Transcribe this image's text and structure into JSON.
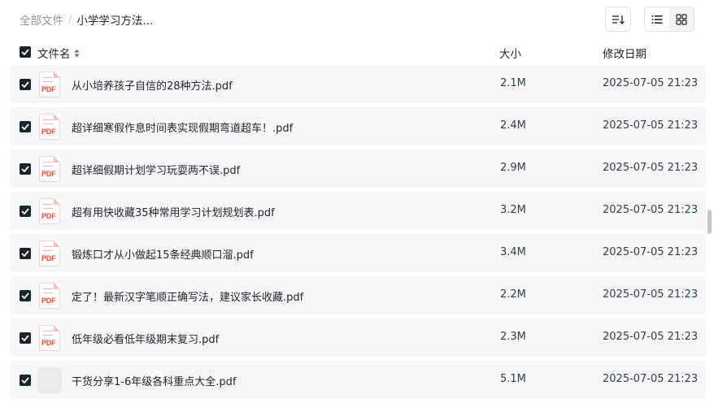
{
  "breadcrumb": {
    "root": "全部文件",
    "separator": "/",
    "current": "小学学习方法..."
  },
  "toolbar": {
    "sort_icon": "sort-list-icon",
    "list_view_icon": "list-view-icon",
    "grid_view_icon": "grid-view-icon",
    "active_view": "list"
  },
  "table": {
    "headers": {
      "name": "文件名",
      "size": "大小",
      "modified": "修改日期"
    },
    "select_all_checked": true,
    "rows": [
      {
        "name": "从小培养孩子自信的28种方法.pdf",
        "size": "2.1M",
        "modified": "2025-07-05 21:23",
        "icon": "pdf-file-icon",
        "checked": true
      },
      {
        "name": "超详细寒假作息时间表实现假期弯道超车！.pdf",
        "size": "2.4M",
        "modified": "2025-07-05 21:23",
        "icon": "pdf-file-icon",
        "checked": true
      },
      {
        "name": "超详细假期计划学习玩耍两不误.pdf",
        "size": "2.9M",
        "modified": "2025-07-05 21:23",
        "icon": "pdf-file-icon",
        "checked": true
      },
      {
        "name": "超有用快收藏35种常用学习计划规划表.pdf",
        "size": "3.2M",
        "modified": "2025-07-05 21:23",
        "icon": "pdf-file-icon",
        "checked": true
      },
      {
        "name": "锻炼口才从小做起15条经典顺口溜.pdf",
        "size": "3.4M",
        "modified": "2025-07-05 21:23",
        "icon": "pdf-file-icon",
        "checked": true
      },
      {
        "name": "定了！最新汉字笔顺正确写法，建议家长收藏.pdf",
        "size": "2.2M",
        "modified": "2025-07-05 21:23",
        "icon": "pdf-file-icon",
        "checked": true
      },
      {
        "name": "低年级必看低年级期末复习.pdf",
        "size": "2.3M",
        "modified": "2025-07-05 21:23",
        "icon": "pdf-file-icon",
        "checked": true
      },
      {
        "name": "干货分享1-6年级各科重点大全.pdf",
        "size": "5.1M",
        "modified": "2025-07-05 21:23",
        "icon": "file-placeholder-icon",
        "checked": true
      }
    ]
  },
  "pdf_badge": "PDF",
  "colors": {
    "checkbox": "#1f2329",
    "row_background": "#f5f6f7",
    "pdf_red": "#e2483d",
    "muted_text": "#8f959e"
  }
}
